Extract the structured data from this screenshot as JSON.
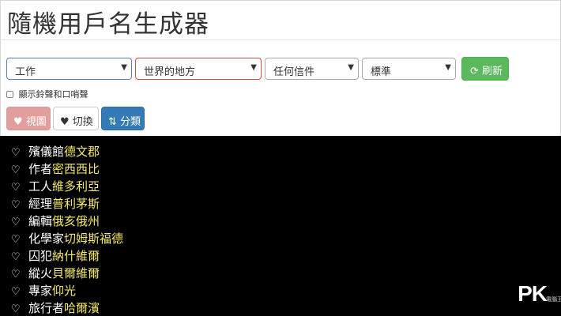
{
  "header": {
    "title": "隨機用戶名生成器"
  },
  "filters": {
    "occupation": "工作",
    "region": "世界的地方",
    "initial": "任何信件",
    "style": "標準"
  },
  "buttons": {
    "refresh": "刷新",
    "view": "視圖",
    "toggle": "切換",
    "sort": "分類"
  },
  "options": {
    "show_bell": "顯示鈴聲和口哨聲"
  },
  "results": [
    {
      "prefix": "殯儀館",
      "name": "德文郡"
    },
    {
      "prefix": "作者",
      "name": "密西西比"
    },
    {
      "prefix": "工人",
      "name": "維多利亞"
    },
    {
      "prefix": "經理",
      "name": "普利茅斯"
    },
    {
      "prefix": "編輯",
      "name": "俄亥俄州"
    },
    {
      "prefix": "化學家",
      "name": "切姆斯福德"
    },
    {
      "prefix": "囚犯",
      "name": "納什維爾"
    },
    {
      "prefix": "縱火",
      "name": "貝爾維爾"
    },
    {
      "prefix": "專家",
      "name": "仰光"
    },
    {
      "prefix": "旅行者",
      "name": "哈爾濱"
    }
  ],
  "watermark": {
    "logo": "PK",
    "sub": "電腦王阿達"
  },
  "colors": {
    "refresh": "#5cb85c",
    "view": "#e29e9d",
    "sort": "#337ab7",
    "name_highlight": "#f5e96b"
  }
}
